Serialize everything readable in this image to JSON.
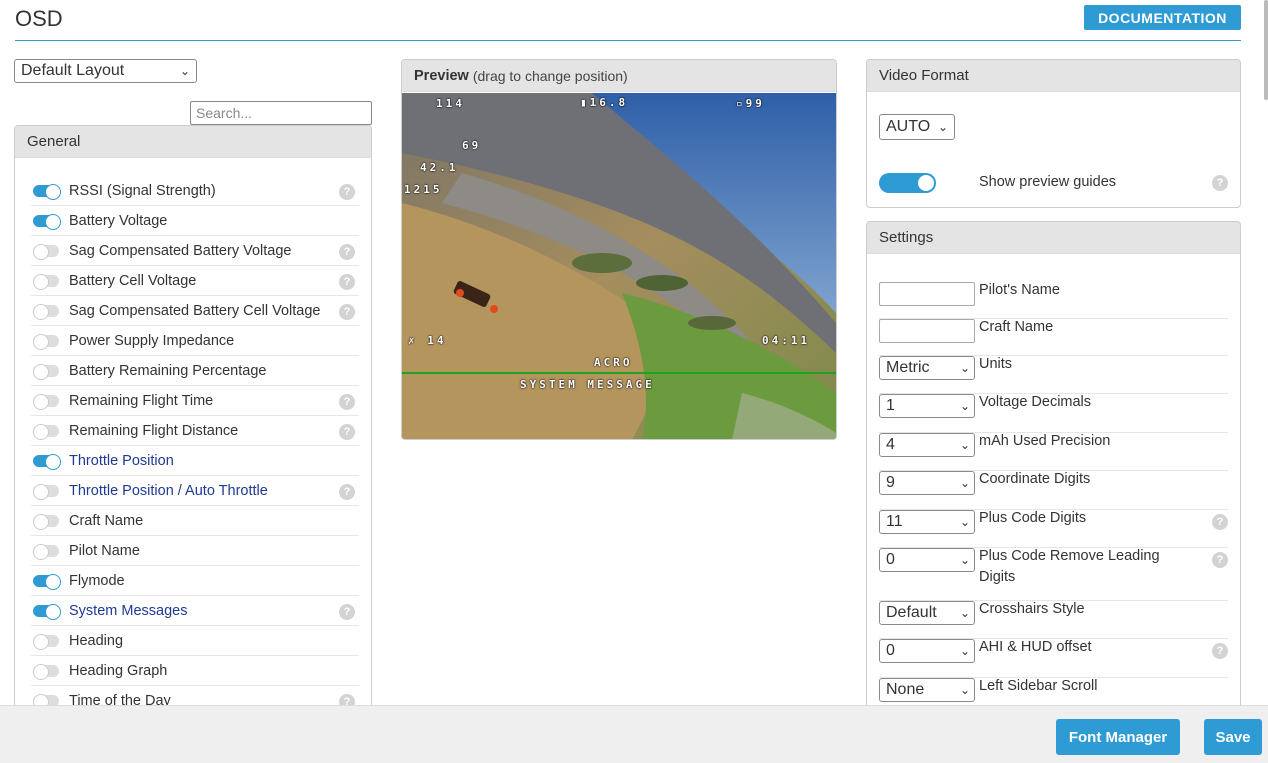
{
  "page": {
    "title": "OSD",
    "doc_label": "DOCUMENTATION"
  },
  "layout_select": {
    "value": "Default Layout"
  },
  "search": {
    "placeholder": "Search..."
  },
  "general": {
    "title": "General",
    "items": [
      {
        "label": "RSSI (Signal Strength)",
        "on": true,
        "help": true,
        "blue": false
      },
      {
        "label": "Battery Voltage",
        "on": true,
        "help": false,
        "blue": false
      },
      {
        "label": "Sag Compensated Battery Voltage",
        "on": false,
        "help": true,
        "blue": false
      },
      {
        "label": "Battery Cell Voltage",
        "on": false,
        "help": true,
        "blue": false
      },
      {
        "label": "Sag Compensated Battery Cell Voltage",
        "on": false,
        "help": true,
        "blue": false
      },
      {
        "label": "Power Supply Impedance",
        "on": false,
        "help": false,
        "blue": false
      },
      {
        "label": "Battery Remaining Percentage",
        "on": false,
        "help": false,
        "blue": false
      },
      {
        "label": "Remaining Flight Time",
        "on": false,
        "help": true,
        "blue": false
      },
      {
        "label": "Remaining Flight Distance",
        "on": false,
        "help": true,
        "blue": false
      },
      {
        "label": "Throttle Position",
        "on": true,
        "help": false,
        "blue": true
      },
      {
        "label": "Throttle Position / Auto Throttle",
        "on": false,
        "help": true,
        "blue": true
      },
      {
        "label": "Craft Name",
        "on": false,
        "help": false,
        "blue": false
      },
      {
        "label": "Pilot Name",
        "on": false,
        "help": false,
        "blue": false
      },
      {
        "label": "Flymode",
        "on": true,
        "help": false,
        "blue": false
      },
      {
        "label": "System Messages",
        "on": true,
        "help": true,
        "blue": true
      },
      {
        "label": "Heading",
        "on": false,
        "help": false,
        "blue": false
      },
      {
        "label": "Heading Graph",
        "on": false,
        "help": false,
        "blue": false
      },
      {
        "label": "Time of the Day",
        "on": false,
        "help": true,
        "blue": false
      }
    ]
  },
  "preview": {
    "title": "Preview",
    "subtitle": "(drag to change position)",
    "osd": {
      "altitude": "114",
      "battery": "16.8",
      "rssi": "99",
      "speed": "69",
      "current": "42.1",
      "mah": "1215",
      "sats": "14",
      "flytime": "04:11",
      "flymode": "ACRO",
      "message": "SYSTEM MESSAGE"
    }
  },
  "video_format": {
    "title": "Video Format",
    "value": "AUTO",
    "guides_label": "Show preview guides"
  },
  "settings": {
    "title": "Settings",
    "rows": [
      {
        "kind": "text",
        "value": "",
        "label": "Pilot's Name",
        "help": false
      },
      {
        "kind": "text",
        "value": "",
        "label": "Craft Name",
        "help": false
      },
      {
        "kind": "select",
        "value": "Metric",
        "label": "Units",
        "help": false
      },
      {
        "kind": "select",
        "value": "1",
        "label": "Voltage Decimals",
        "help": false
      },
      {
        "kind": "select",
        "value": "4",
        "label": "mAh Used Precision",
        "help": false
      },
      {
        "kind": "select",
        "value": "9",
        "label": "Coordinate Digits",
        "help": false
      },
      {
        "kind": "select",
        "value": "11",
        "label": "Plus Code Digits",
        "help": true
      },
      {
        "kind": "select",
        "value": "0",
        "label": "Plus Code Remove Leading Digits",
        "help": true
      },
      {
        "kind": "select",
        "value": "Default",
        "label": "Crosshairs Style",
        "help": false
      },
      {
        "kind": "select",
        "value": "0",
        "label": "AHI & HUD offset",
        "help": true
      },
      {
        "kind": "select",
        "value": "None",
        "label": "Left Sidebar Scroll",
        "help": false
      }
    ]
  },
  "footer": {
    "font_manager": "Font Manager",
    "save": "Save"
  },
  "colors": {
    "accent": "#2e9bd5",
    "link_blue": "#1f3a93",
    "horizon": "#1ca51c"
  }
}
